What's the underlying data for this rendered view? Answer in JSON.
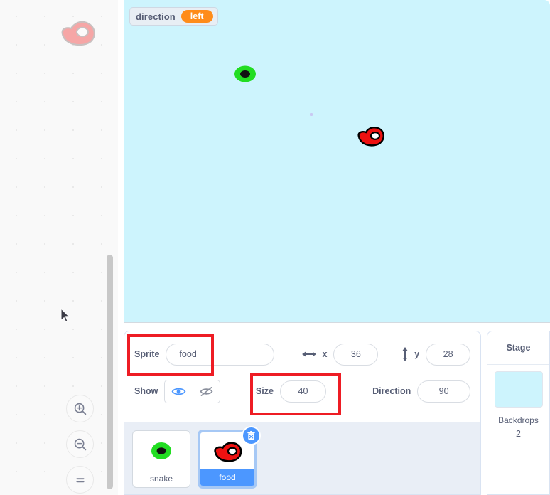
{
  "app": {
    "name": "scratch-editor"
  },
  "code_area": {
    "watermark_sprite": "food-sprite-faded",
    "zoom_controls": [
      {
        "name": "zoom-in-button",
        "icon": "magnifier-plus-icon"
      },
      {
        "name": "zoom-out-button",
        "icon": "magnifier-minus-icon"
      },
      {
        "name": "zoom-reset-button",
        "icon": "equals-icon"
      }
    ],
    "scrollbar": "vertical-scrollbar"
  },
  "stage": {
    "background_color": "#cdf4fd",
    "monitor": {
      "label": "direction",
      "value": "left",
      "value_color": "#ff8c1a"
    },
    "sprites": [
      {
        "name": "snake",
        "shape": "green-ellipse-with-black-center",
        "color": "#22dd22"
      },
      {
        "name": "food",
        "shape": "red-bean-with-white-hole",
        "color": "#ee1111"
      }
    ],
    "cursor": "mouse-pointer"
  },
  "sprite_info": {
    "sprite_label": "Sprite",
    "sprite_name": "food",
    "sprite_name_placeholder": "Sprite",
    "x_label": "x",
    "x_value": "36",
    "y_label": "y",
    "y_value": "28",
    "show_label": "Show",
    "show_on_icon": "eye-icon",
    "show_off_icon": "eye-slash-icon",
    "show_state": "visible",
    "size_label": "Size",
    "size_value": "40",
    "direction_label": "Direction",
    "direction_value": "90"
  },
  "sprite_list": {
    "sprites": [
      {
        "name": "snake",
        "selected": false
      },
      {
        "name": "food",
        "selected": true,
        "delete_badge": "trash-icon"
      }
    ]
  },
  "stage_selector": {
    "title": "Stage",
    "thumbnail_color": "#cdf4fd",
    "backdrops_label": "Backdrops",
    "backdrops_count": "2"
  },
  "annotations": {
    "color": "#ee1c24",
    "boxes": [
      {
        "name": "sprite-name-highlight",
        "target": "Sprite food"
      },
      {
        "name": "size-field-highlight",
        "target": "Size 40"
      }
    ]
  }
}
